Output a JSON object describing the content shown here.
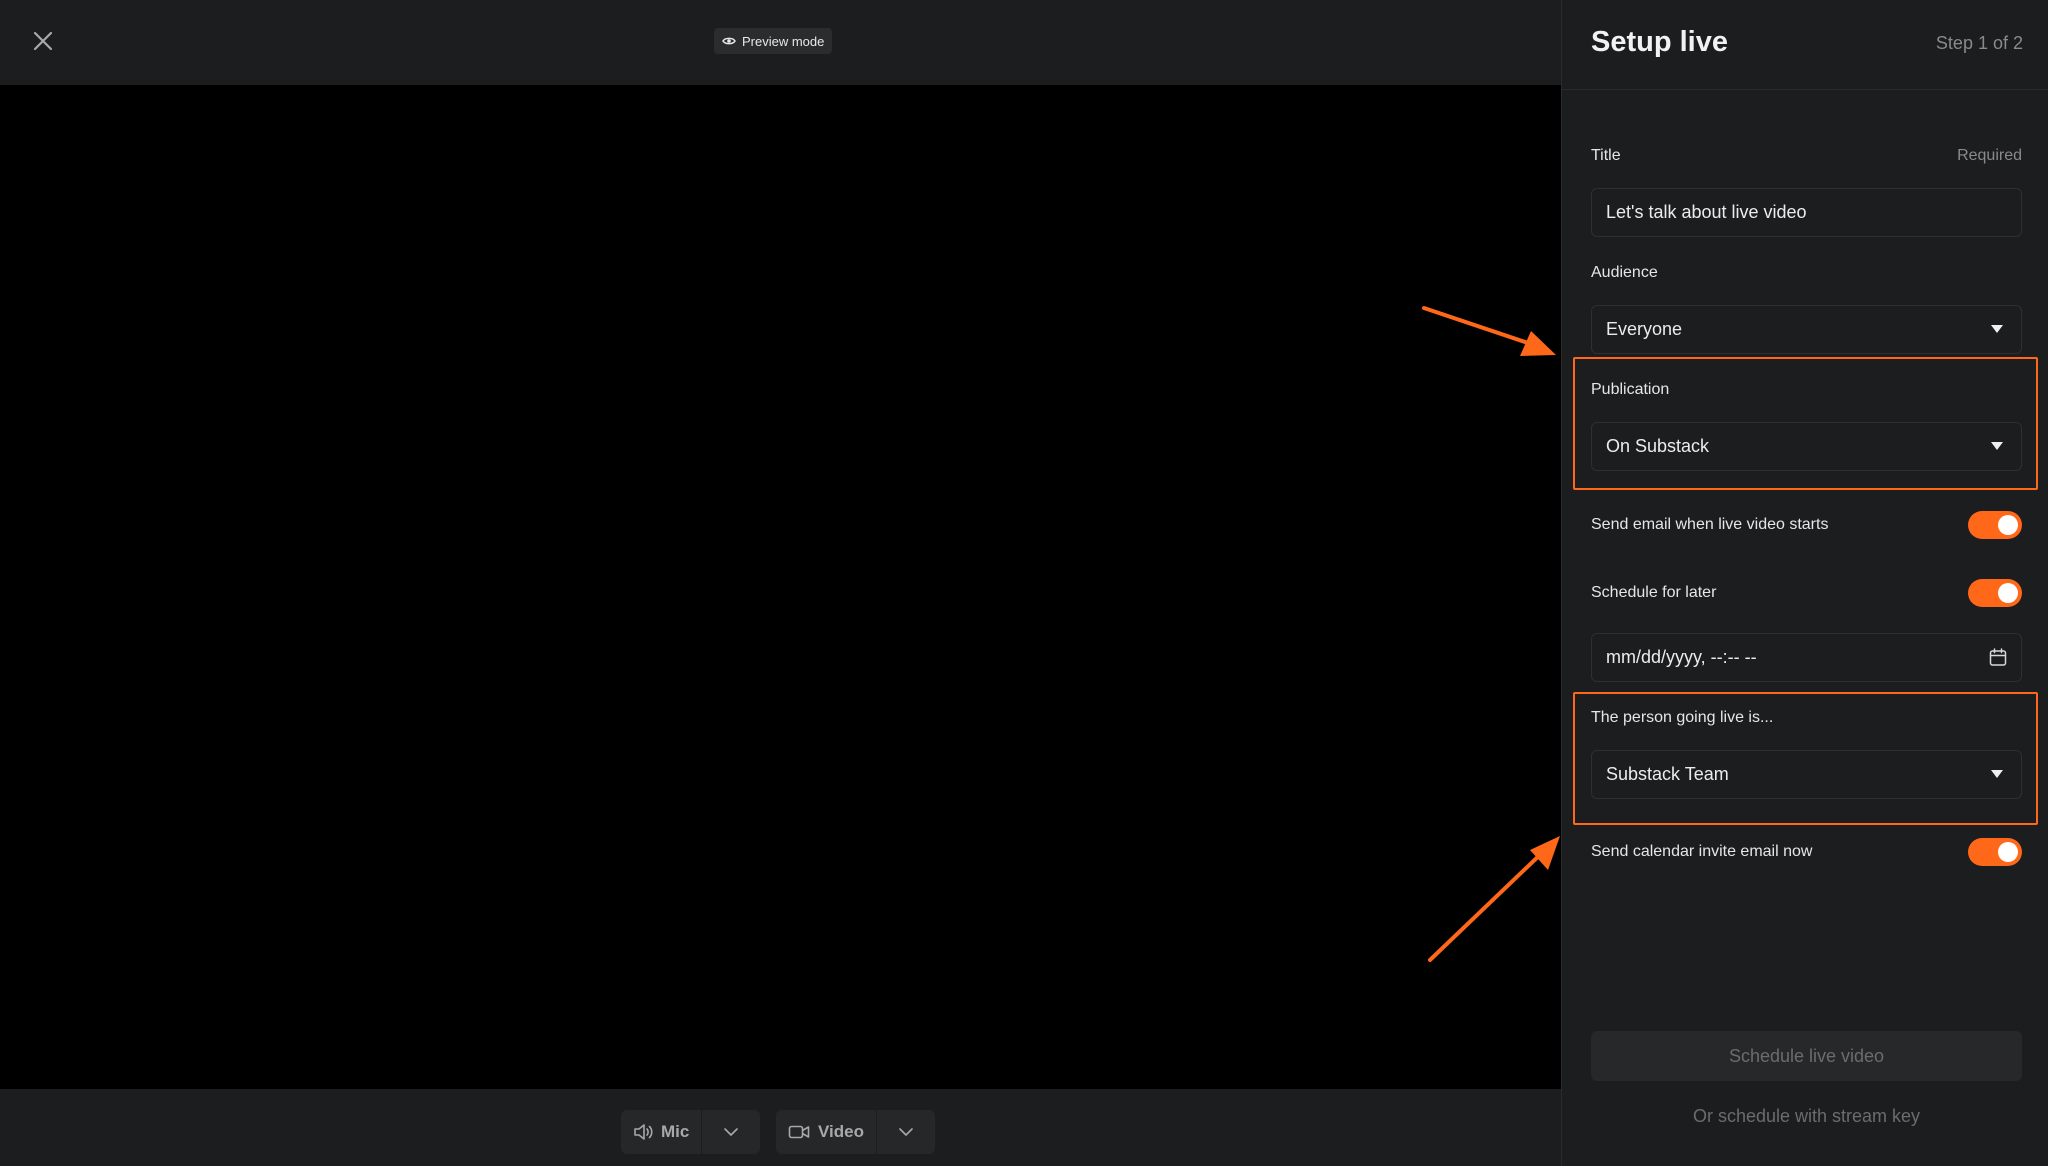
{
  "preview": {
    "label": "Preview mode",
    "icon": "eye-icon"
  },
  "controls": {
    "mic_label": "Mic",
    "video_label": "Video"
  },
  "panel": {
    "title": "Setup live",
    "step": "Step 1 of 2",
    "title_field": {
      "label": "Title",
      "required": "Required",
      "value": "Let's talk about live video"
    },
    "audience": {
      "label": "Audience",
      "value": "Everyone"
    },
    "publication": {
      "label": "Publication",
      "value": "On Substack"
    },
    "send_email": {
      "label": "Send email when live video starts",
      "on": true
    },
    "schedule_later": {
      "label": "Schedule for later",
      "on": true
    },
    "datetime": {
      "placeholder": "mm/dd/yyyy, --:-- --"
    },
    "person": {
      "label": "The person going live is...",
      "value": "Substack Team"
    },
    "calendar_invite": {
      "label": "Send calendar invite email now",
      "on": true
    },
    "schedule_button": "Schedule live video",
    "stream_key_link": "Or schedule with stream key"
  },
  "colors": {
    "accent": "#ff6719",
    "background": "#1c1d1f",
    "stage": "#000000"
  }
}
